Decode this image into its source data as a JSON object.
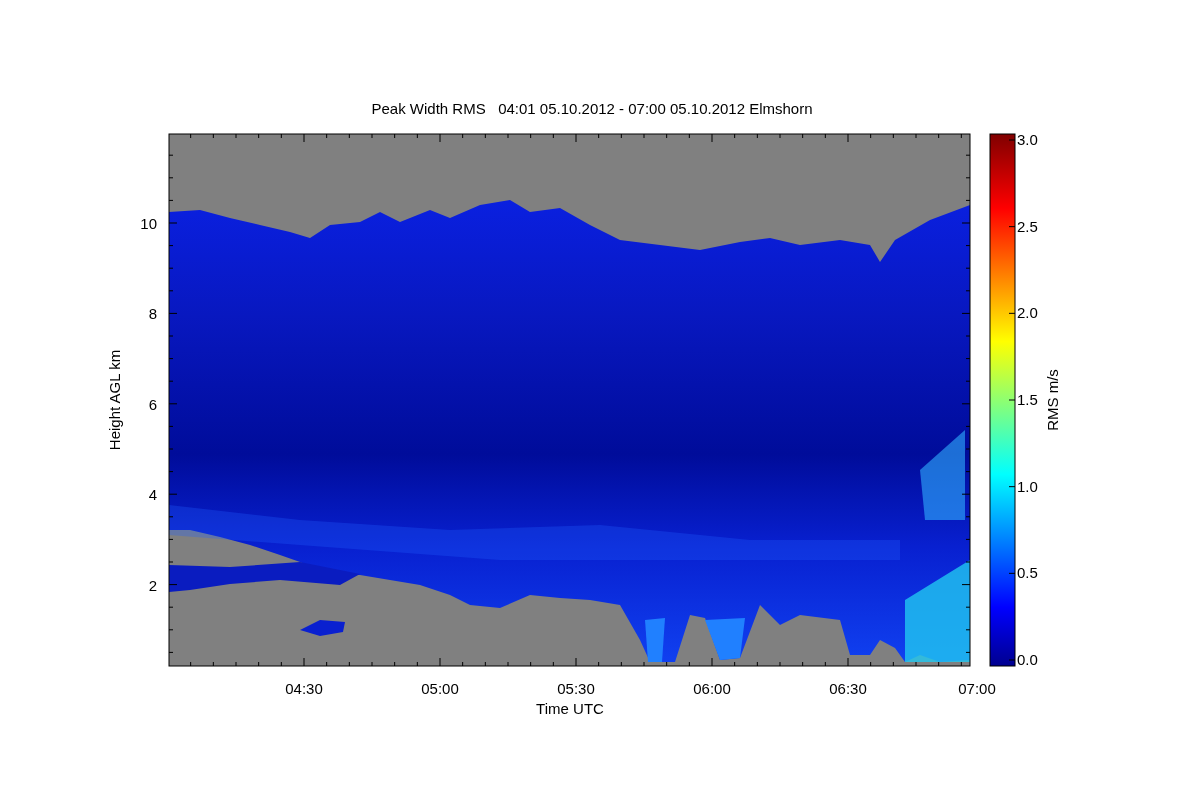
{
  "title": "Peak Width RMS   04:01 05.10.2012 - 07:00 05.10.2012 Elmshorn",
  "y_axis": {
    "label": "Height AGL km",
    "ticks": [
      "10",
      "8",
      "6",
      "4",
      "2"
    ]
  },
  "x_axis": {
    "label": "Time UTC",
    "ticks": [
      "04:30",
      "05:00",
      "05:30",
      "06:00",
      "06:30",
      "07:00"
    ]
  },
  "colorbar": {
    "label": "RMS m/s",
    "ticks": [
      "3.0",
      "2.5",
      "2.0",
      "1.5",
      "1.0",
      "0.5",
      "0.0"
    ]
  }
}
